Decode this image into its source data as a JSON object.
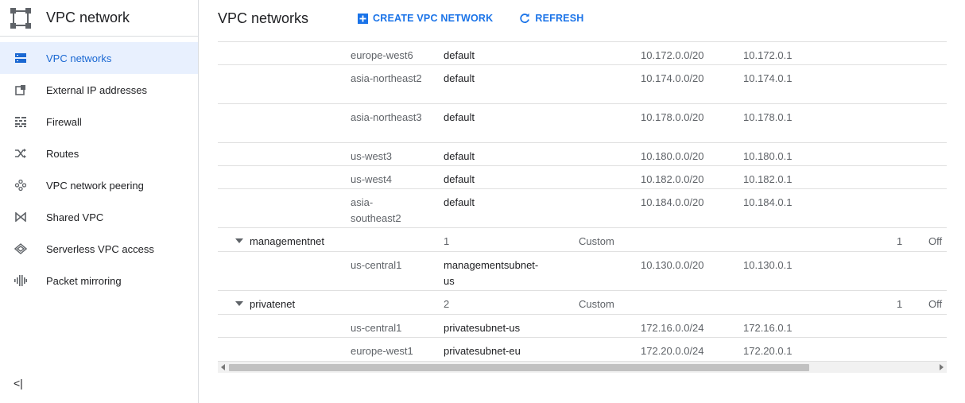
{
  "sidebar": {
    "title": "VPC network",
    "items": [
      {
        "label": "VPC networks",
        "icon": "vpc-networks-icon"
      },
      {
        "label": "External IP addresses",
        "icon": "external-ip-icon"
      },
      {
        "label": "Firewall",
        "icon": "firewall-icon"
      },
      {
        "label": "Routes",
        "icon": "routes-icon"
      },
      {
        "label": "VPC network peering",
        "icon": "peering-icon"
      },
      {
        "label": "Shared VPC",
        "icon": "shared-vpc-icon"
      },
      {
        "label": "Serverless VPC access",
        "icon": "serverless-icon"
      },
      {
        "label": "Packet mirroring",
        "icon": "packet-mirroring-icon"
      }
    ],
    "collapse_label": "<|"
  },
  "header": {
    "title": "VPC networks",
    "create_label": "CREATE VPC NETWORK",
    "refresh_label": "REFRESH"
  },
  "colors": {
    "accent": "#1a73e8",
    "active_bg": "#e8f0fe"
  },
  "table": {
    "subnet_rows_top": [
      {
        "region": "europe-west6",
        "subnet": "default",
        "range": "10.172.0.0/20",
        "gateway": "10.172.0.1"
      },
      {
        "region": "asia-northeast2",
        "subnet": "default",
        "range": "10.174.0.0/20",
        "gateway": "10.174.0.1"
      },
      {
        "region": "asia-northeast3",
        "subnet": "default",
        "range": "10.178.0.0/20",
        "gateway": "10.178.0.1"
      },
      {
        "region": "us-west3",
        "subnet": "default",
        "range": "10.180.0.0/20",
        "gateway": "10.180.0.1"
      },
      {
        "region": "us-west4",
        "subnet": "default",
        "range": "10.182.0.0/20",
        "gateway": "10.182.0.1"
      },
      {
        "region": "asia-southeast2",
        "subnet": "default",
        "range": "10.184.0.0/20",
        "gateway": "10.184.0.1"
      }
    ],
    "networks": [
      {
        "name": "managementnet",
        "subnets": "1",
        "mode": "Custom",
        "bgp": "1",
        "logs": "Off",
        "rows": [
          {
            "region": "us-central1",
            "subnet": "managementsubnet-us",
            "range": "10.130.0.0/20",
            "gateway": "10.130.0.1"
          }
        ]
      },
      {
        "name": "privatenet",
        "subnets": "2",
        "mode": "Custom",
        "bgp": "1",
        "logs": "Off",
        "rows": [
          {
            "region": "us-central1",
            "subnet": "privatesubnet-us",
            "range": "172.16.0.0/24",
            "gateway": "172.16.0.1"
          },
          {
            "region": "europe-west1",
            "subnet": "privatesubnet-eu",
            "range": "172.20.0.0/24",
            "gateway": "172.20.0.1"
          }
        ]
      }
    ]
  }
}
